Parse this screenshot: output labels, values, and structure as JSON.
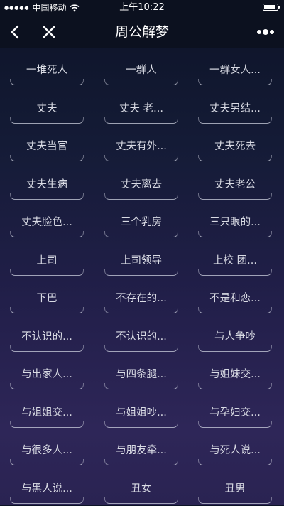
{
  "status_bar": {
    "carrier": "中国移动",
    "time": "上午10:22",
    "signal_icon": "signal-dots-icon",
    "wifi_icon": "wifi-icon",
    "battery_icon": "battery-icon"
  },
  "nav": {
    "title": "周公解梦",
    "back_icon": "back-arrow-icon",
    "close_icon": "close-icon",
    "more_icon": "more-dots-icon"
  },
  "colors": {
    "bar_background": "#0c111f",
    "page_gradient_top": "#0d1327",
    "page_gradient_bottom": "#2a2352",
    "label_text": "#d9dbe4"
  },
  "rows": [
    [
      "一堆死人",
      "一群人",
      "一群女人..."
    ],
    [
      "丈夫",
      "丈夫 老...",
      "丈夫另结..."
    ],
    [
      "丈夫当官",
      "丈夫有外...",
      "丈夫死去"
    ],
    [
      "丈夫生病",
      "丈夫离去",
      "丈夫老公"
    ],
    [
      "丈夫脸色...",
      "三个乳房",
      "三只眼的..."
    ],
    [
      "上司",
      "上司领导",
      "上校 团..."
    ],
    [
      "下巴",
      "不存在的...",
      "不是和恋..."
    ],
    [
      "不认识的...",
      "不认识的...",
      "与人争吵"
    ],
    [
      "与出家人...",
      "与四条腿...",
      "与姐妹交..."
    ],
    [
      "与姐姐交...",
      "与姐姐吵...",
      "与孕妇交..."
    ],
    [
      "与很多人...",
      "与朋友牵...",
      "与死人说..."
    ],
    [
      "与黑人说...",
      "丑女",
      "丑男"
    ]
  ]
}
